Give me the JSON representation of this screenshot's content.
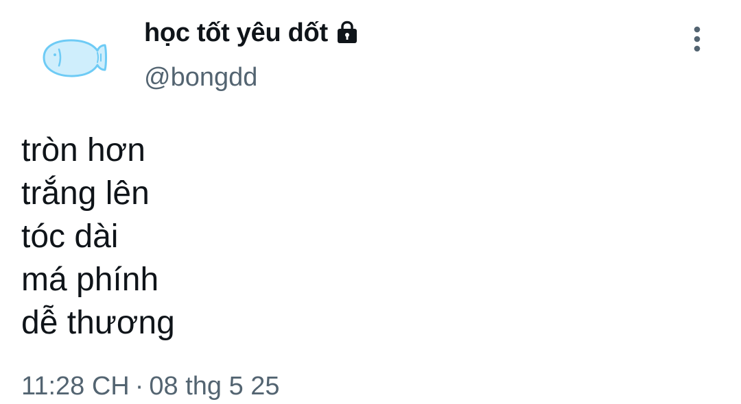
{
  "profile": {
    "display_name": "học tốt yêu dốt",
    "handle": "@bongdd",
    "avatar_icon": "fish-icon",
    "protected_icon": "lock-icon"
  },
  "more_menu": {
    "icon": "more-vertical-icon"
  },
  "tweet": {
    "lines": [
      "tròn hơn",
      "trắng lên",
      "tóc dài",
      "má phính",
      "dễ thương"
    ]
  },
  "meta": {
    "time": "11:28 CH",
    "separator": "·",
    "date": "08 thg 5 25"
  },
  "colors": {
    "text_primary": "#0f1419",
    "text_secondary": "#536471",
    "avatar_fill": "#cfeefc",
    "avatar_stroke": "#6ecbf5"
  }
}
